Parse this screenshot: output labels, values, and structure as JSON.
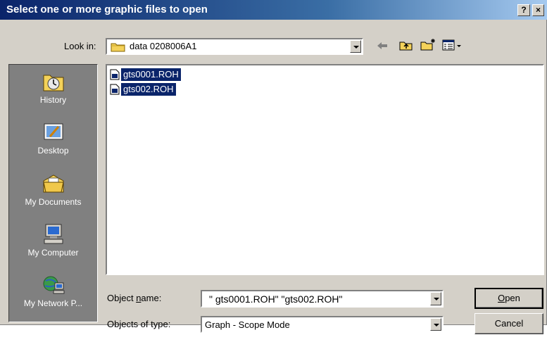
{
  "window": {
    "title": "Select one or more graphic files to open",
    "help_label": "?",
    "close_label": "×"
  },
  "look_in": {
    "label": "Look in:",
    "value": "data 0208006A1"
  },
  "toolbar": {
    "back_icon": "back-arrow-icon",
    "up_icon": "up-folder-icon",
    "new_folder_icon": "new-folder-icon",
    "views_icon": "views-menu-icon"
  },
  "places_bar": [
    {
      "label": "History",
      "icon": "history-icon"
    },
    {
      "label": "Desktop",
      "icon": "desktop-icon"
    },
    {
      "label": "My Documents",
      "icon": "my-documents-icon"
    },
    {
      "label": "My Computer",
      "icon": "my-computer-icon"
    },
    {
      "label": "My Network P...",
      "icon": "my-network-places-icon"
    }
  ],
  "files": [
    {
      "name": "gts0001.ROH",
      "selected": true
    },
    {
      "name": "gts002.ROH",
      "selected": true
    }
  ],
  "object_name": {
    "label_pre": "Object ",
    "label_u": "n",
    "label_post": "ame:",
    "value": "\" gts0001.ROH\" \"gts002.ROH\""
  },
  "object_type": {
    "label": "Objects of type:",
    "value": "Graph - Scope Mode"
  },
  "buttons": {
    "open_u": "O",
    "open_rest": "pen",
    "cancel": "Cancel"
  },
  "colors": {
    "selection": "#0a246a",
    "dialog_bg": "#d4d0c8",
    "places_bg": "#808080"
  }
}
